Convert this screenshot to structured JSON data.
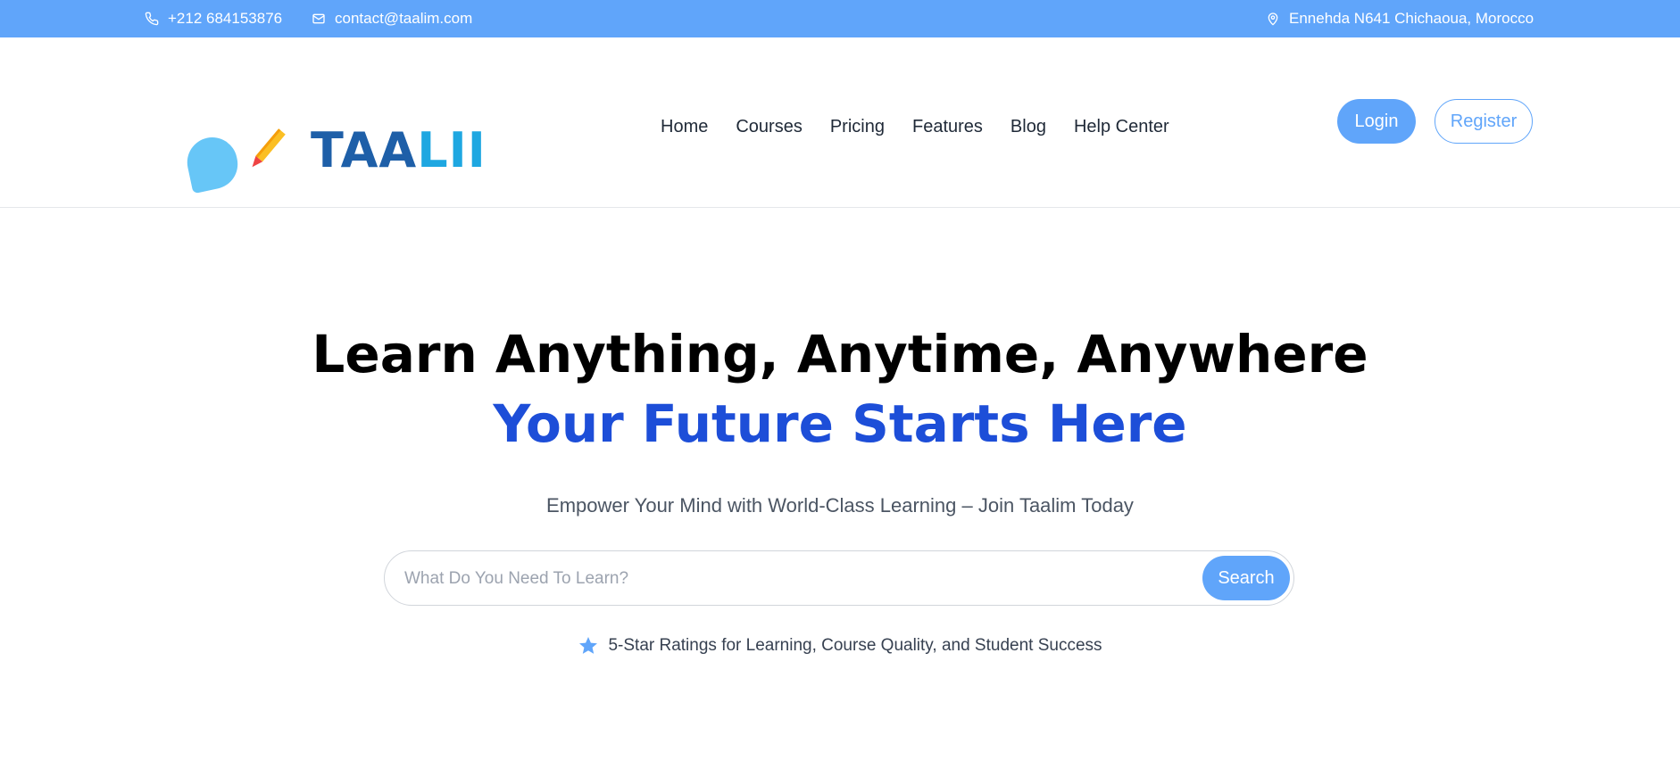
{
  "topbar": {
    "phone": "+212 684153876",
    "email": "contact@taalim.com",
    "address": "Ennehda N641 Chichaoua, Morocco",
    "icons": [
      "phone-icon",
      "mail-icon",
      "location-pin-icon"
    ]
  },
  "logo": {
    "text_a": "TAA",
    "text_b": "LII"
  },
  "nav": {
    "items": [
      "Home",
      "Courses",
      "Pricing",
      "Features",
      "Blog",
      "Help Center"
    ]
  },
  "auth": {
    "login": "Login",
    "register": "Register"
  },
  "hero": {
    "title": "Learn Anything, Anytime, Anywhere",
    "subtitle": "Your Future Starts Here",
    "tagline": "Empower Your Mind with World-Class Learning – Join Taalim Today"
  },
  "search": {
    "placeholder": "What Do You Need To Learn?",
    "value": "",
    "button": "Search"
  },
  "rating": {
    "text": "5-Star Ratings for Learning, Course Quality, and Student Success",
    "icon": "star-icon"
  },
  "colors": {
    "accent": "#60a5fa",
    "heading_blue": "#1d4ed8",
    "text_dark": "#000000"
  }
}
